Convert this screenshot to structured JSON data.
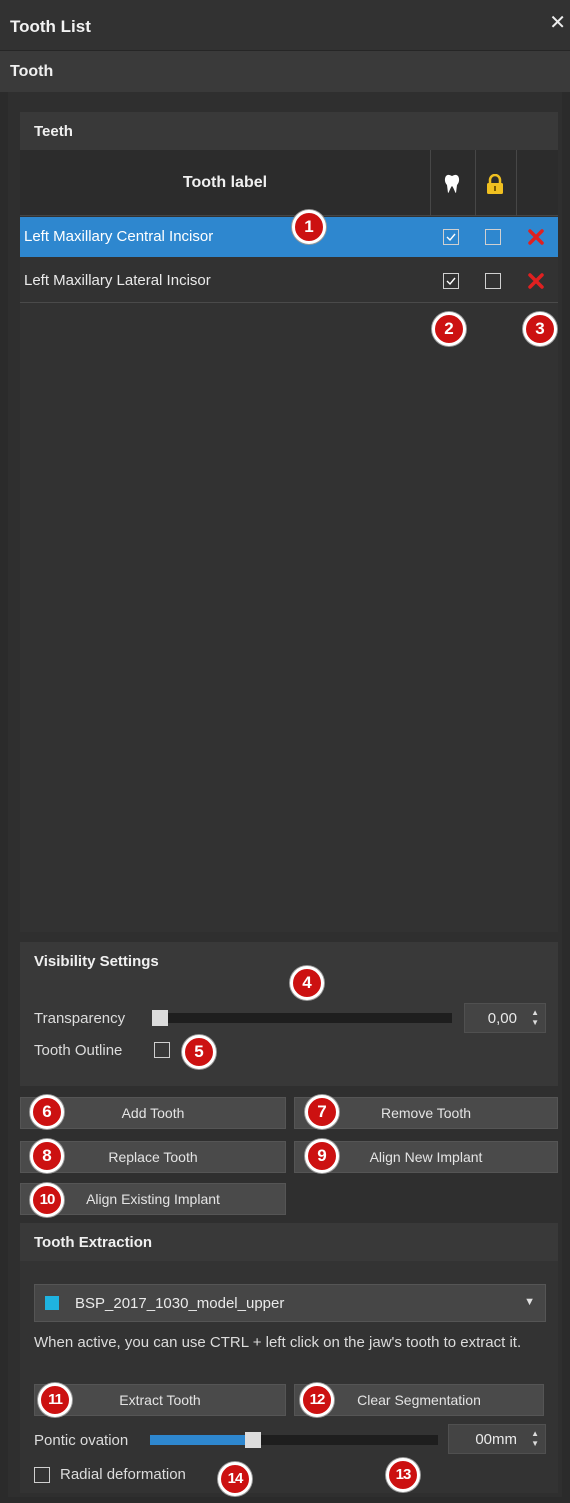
{
  "window": {
    "title": "Tooth List",
    "close_glyph": "✕"
  },
  "section": {
    "title": "Tooth"
  },
  "teeth": {
    "title": "Teeth",
    "columns": {
      "label": "Tooth label",
      "visible_icon": "tooth-icon",
      "lock_icon": "lock-icon"
    },
    "rows": [
      {
        "label": "Left Maxillary Central Incisor",
        "visible": true,
        "locked": false,
        "selected": true
      },
      {
        "label": "Left Maxillary Lateral Incisor",
        "visible": true,
        "locked": false,
        "selected": false
      }
    ]
  },
  "visibility": {
    "title": "Visibility Settings",
    "transparency_label": "Transparency",
    "transparency_value": "0,00",
    "transparency_level": 0,
    "outline_label": "Tooth Outline",
    "outline_checked": false
  },
  "actions": {
    "add": "Add Tooth",
    "remove": "Remove Tooth",
    "replace": "Replace Tooth",
    "align_new": "Align New Implant",
    "align_existing": "Align Existing Implant"
  },
  "extraction": {
    "title": "Tooth Extraction",
    "model": "BSP_2017_1030_model_upper",
    "model_color": "#1fb3e0",
    "description": "When active, you can use CTRL + left click on the jaw's tooth to extract it.",
    "extract_button": "Extract Tooth",
    "clear_button": "Clear Segmentation",
    "pontic_label": "Pontic ovation",
    "pontic_value": "00mm",
    "pontic_level": 0.35,
    "radial_label": "Radial deformation",
    "radial_checked": false
  },
  "callouts": [
    "1",
    "2",
    "3",
    "4",
    "5",
    "6",
    "7",
    "8",
    "9",
    "10",
    "11",
    "12",
    "13",
    "14"
  ],
  "colors": {
    "accent": "#2e87cf",
    "delete": "#e02020",
    "lock": "#f0c020",
    "callout": "#cc1111"
  }
}
